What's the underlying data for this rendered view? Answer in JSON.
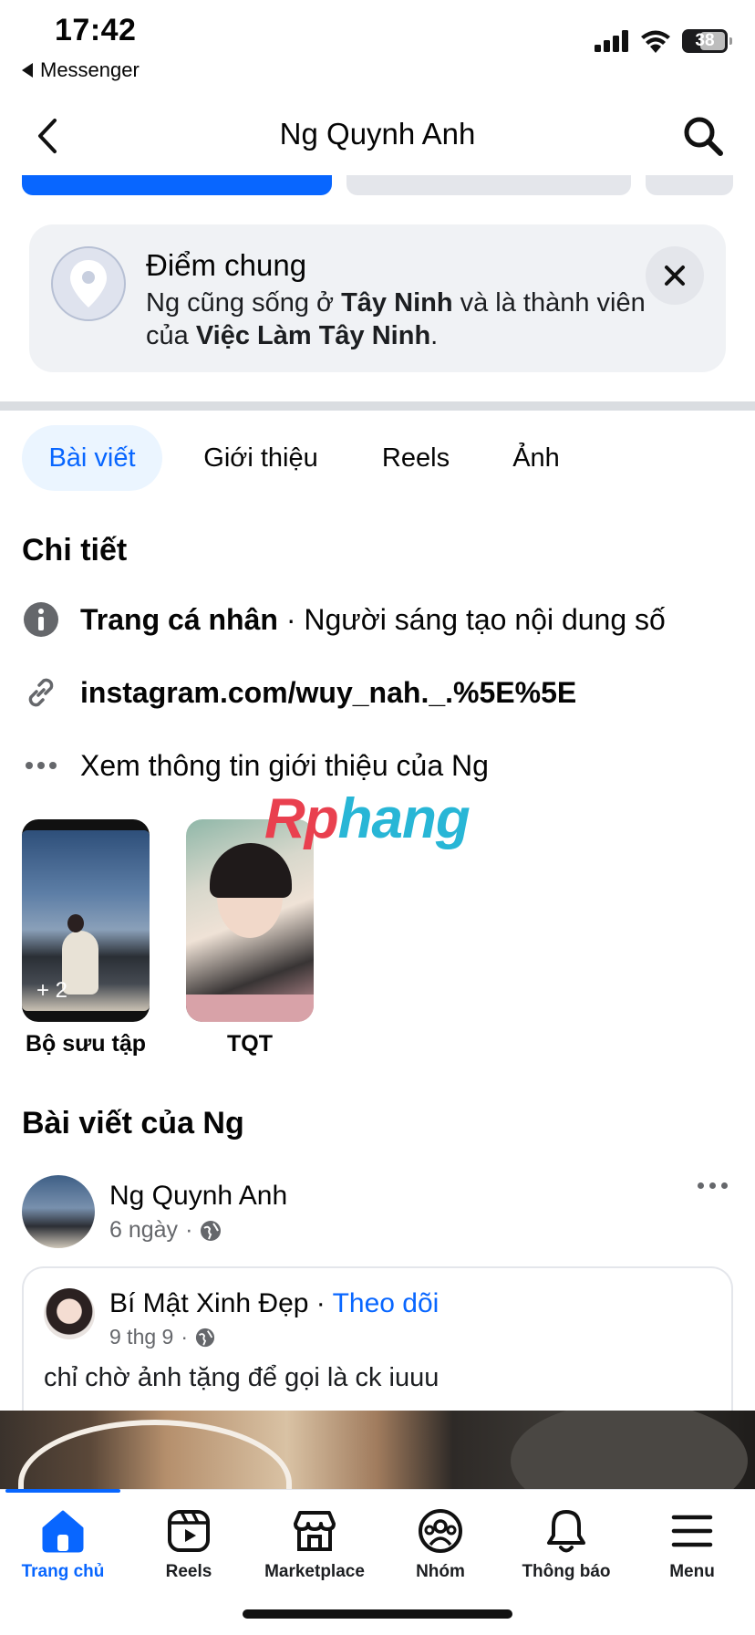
{
  "status_bar": {
    "time": "17:42",
    "back_app": "Messenger",
    "battery": "38"
  },
  "header": {
    "title": "Ng Quynh Anh"
  },
  "common": {
    "title": "Điểm chung",
    "text_pre": "Ng cũng sống ở ",
    "place": "Tây Ninh",
    "text_mid": " và là thành viên của ",
    "group": "Việc Làm Tây Ninh",
    "text_end": "."
  },
  "tabs": [
    "Bài viết",
    "Giới thiệu",
    "Reels",
    "Ảnh"
  ],
  "details": {
    "title": "Chi tiết",
    "profile_label": "Trang cá nhân",
    "profile_sep": " · ",
    "profile_value": "Người sáng tạo nội dung số",
    "link": "instagram.com/wuy_nah._.%5E%5E",
    "see_more": "Xem thông tin giới thiệu của Ng"
  },
  "highlights": [
    {
      "label": "Bộ sưu tập",
      "badge": "+ 2"
    },
    {
      "label": "TQT"
    }
  ],
  "watermark": {
    "part1": "Rp",
    "part2": "hang"
  },
  "posts": {
    "title": "Bài viết của Ng",
    "author": "Ng Quynh Anh",
    "time": "6 ngày",
    "sep": "·",
    "shared": {
      "author": "Bí Mật Xinh Đẹp",
      "sep": " · ",
      "follow": "Theo dõi",
      "time": "9 thg 9",
      "text": "chỉ chờ ảnh tặng để gọi là ck iuuu"
    }
  },
  "tabbar": [
    {
      "label": "Trang chủ",
      "icon": "home-icon",
      "active": true
    },
    {
      "label": "Reels",
      "icon": "reels-icon"
    },
    {
      "label": "Marketplace",
      "icon": "marketplace-icon"
    },
    {
      "label": "Nhóm",
      "icon": "groups-icon"
    },
    {
      "label": "Thông báo",
      "icon": "bell-icon"
    },
    {
      "label": "Menu",
      "icon": "menu-icon"
    }
  ],
  "colors": {
    "accent": "#0866ff",
    "secondary_text": "#65676b",
    "card_bg": "#f0f2f5"
  }
}
